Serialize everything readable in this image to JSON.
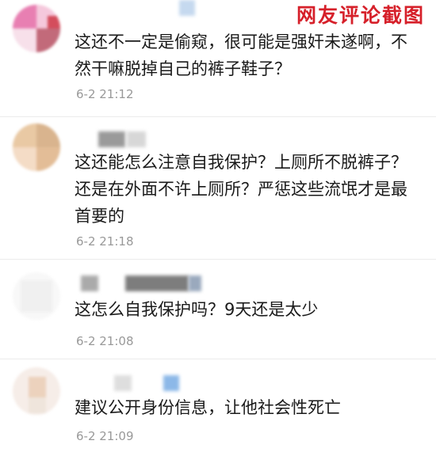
{
  "watermark": {
    "text": "网友评论截图",
    "color": "#d6202a"
  },
  "comments": [
    {
      "text": "这还不一定是偷窥，很可能是强奸未遂啊，不然干嘛脱掉自己的裤子鞋子？",
      "time": "6-2 21:12",
      "avatar_icon": "blurred-avatar-icon"
    },
    {
      "text": "这还能怎么注意自我保护？上厕所不脱裤子？还是在外面不许上厕所？严惩这些流氓才是最首要的",
      "time": "6-2 21:18",
      "avatar_icon": "blurred-avatar-icon"
    },
    {
      "text": "这怎么自我保护吗？9天还是太少",
      "time": "6-2 21:08",
      "avatar_icon": "blurred-avatar-icon"
    },
    {
      "text": "建议公开身份信息，让他社会性死亡",
      "time": "6-2 21:09",
      "avatar_icon": "blurred-avatar-icon"
    }
  ],
  "colors": {
    "text": "#1a1a1a",
    "timestamp": "#999999",
    "divider": "#ebebeb"
  }
}
